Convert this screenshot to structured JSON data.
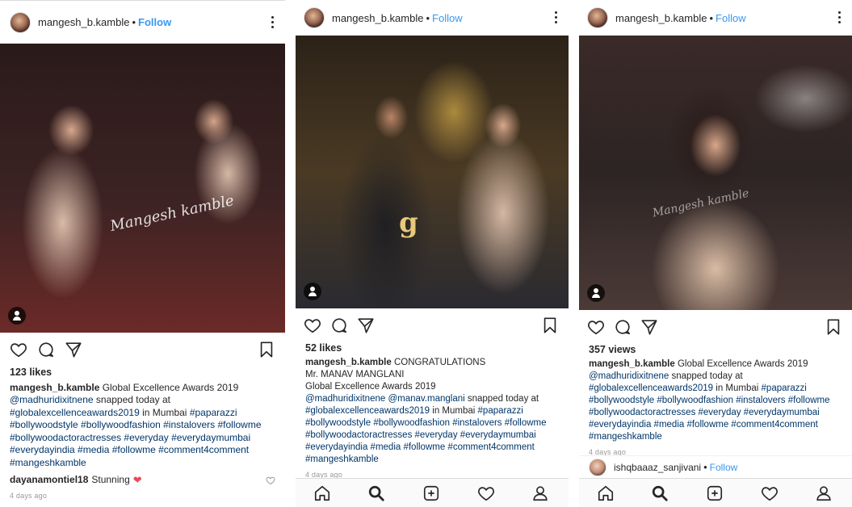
{
  "posts": [
    {
      "username": "mangesh_b.kamble",
      "follow_label": "Follow",
      "watermark": "Mangesh kamble",
      "likes": "123 likes",
      "caption_user": "mangesh_b.kamble",
      "caption_lines": [
        "Global Excellence Awards 2019"
      ],
      "mention_line_prefix": "@madhuridixitnene",
      "mention_line_rest": " snapped today at",
      "hashtag_line_1a": "#globalexcellenceawards2019",
      "hashtag_line_1b": " in Mumbai ",
      "hashtag_line_1c": "#paparazzi",
      "hashtag_line_2": "#bollywoodstyle #bollywoodfashion #instalovers #followme",
      "hashtag_line_3": "#bollywoodactoractresses #everyday #everydaymumbai",
      "hashtag_line_4": "#everydayindia #media #followme #comment4comment",
      "hashtag_line_5": "#mangeshkamble",
      "comment_user": "dayanamontiel18",
      "comment_text": "Stunning",
      "time": "4 days ago"
    },
    {
      "username": "mangesh_b.kamble",
      "follow_label": "Follow",
      "likes": "52 likes",
      "caption_user": "mangesh_b.kamble",
      "caption_first": "CONGRATULATIONS",
      "caption_line2": "Mr. MANAV MANGLANI",
      "caption_line3": "Global Excellence Awards 2019",
      "mention_line_a": "@madhuridixitnene",
      "mention_line_b": "@manav.manglani",
      "mention_line_rest": " snapped today at",
      "hashtag_line_1a": "#globalexcellenceawards2019",
      "hashtag_line_1b": " in Mumbai ",
      "hashtag_line_1c": "#paparazzi",
      "hashtag_line_2": "#bollywoodstyle #bollywoodfashion #instalovers #followme",
      "hashtag_line_3": "#bollywoodactoractresses #everyday #everydaymumbai",
      "hashtag_line_4": "#everydayindia #media #followme #comment4comment",
      "hashtag_line_5": "#mangeshkamble",
      "time": "4 days ago"
    },
    {
      "username": "mangesh_b.kamble",
      "follow_label": "Follow",
      "watermark": "Mangesh kamble",
      "views": "357 views",
      "caption_user": "mangesh_b.kamble",
      "caption_first": "Global Excellence Awards 2019",
      "mention_line_prefix": "@madhuridixitnene",
      "mention_line_rest": " snapped today at",
      "hashtag_line_1a": "#globalexcellenceawards2019",
      "hashtag_line_1b": " in Mumbai ",
      "hashtag_line_1c": "#paparazzi",
      "hashtag_line_2": "#bollywoodstyle #bollywoodfashion #instalovers #followme",
      "hashtag_line_3": "#bollywoodactoractresses #everyday #everydaymumbai",
      "hashtag_line_4": "#everydayindia #media #followme #comment4comment",
      "hashtag_line_5": "#mangeshkamble",
      "time": "4 days ago",
      "next_user": "ishqbaaaz_sanjivani",
      "next_follow": "Follow"
    }
  ],
  "colors": {
    "link": "#003569",
    "follow": "#3897f0",
    "like_red": "#ed4956"
  }
}
